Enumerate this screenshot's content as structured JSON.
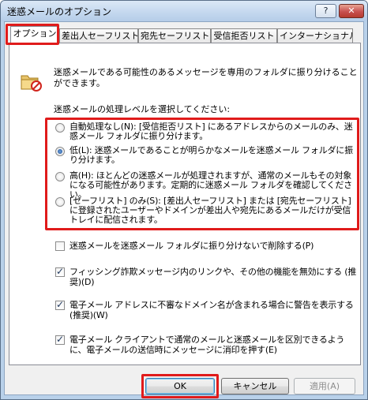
{
  "window": {
    "title": "迷惑メールのオプション",
    "help_label": "?",
    "close_label": "✕"
  },
  "tabs": [
    {
      "label": "オプション",
      "active": true
    },
    {
      "label": "差出人セーフリスト",
      "active": false
    },
    {
      "label": "宛先セーフリスト",
      "active": false
    },
    {
      "label": "受信拒否リスト",
      "active": false
    },
    {
      "label": "インターナショナル",
      "active": false
    }
  ],
  "options": {
    "intro_text": "迷惑メールである可能性のあるメッセージを専用のフォルダに振り分けることができます。",
    "level_label": "迷惑メールの処理レベルを選択してください:",
    "levels": [
      {
        "label": "自動処理なし(N): [受信拒否リスト] にあるアドレスからのメールのみ、迷惑メール フォルダに振り分けます。",
        "checked": false
      },
      {
        "label": "低(L): 迷惑メールであることが明らかなメールを迷惑メール フォルダに振り分けます。",
        "checked": true
      },
      {
        "label": "高(H): ほとんどの迷惑メールが処理されますが、通常のメールもその対象になる可能性があります。定期的に迷惑メール フォルダを確認してください。",
        "checked": false
      },
      {
        "label": "[セーフリスト] のみ(S): [差出人セーフリスト] または [宛先セーフリスト] に登録されたユーザーやドメインが差出人や宛先にあるメールだけが受信トレイに配信されます。",
        "checked": false
      }
    ],
    "checks": [
      {
        "label": "迷惑メールを迷惑メール フォルダに振り分けないで削除する(P)",
        "checked": false
      },
      {
        "label": "フィッシング詐欺メッセージ内のリンクや、その他の機能を無効にする (推奨)(D)",
        "checked": true
      },
      {
        "label": "電子メール アドレスに不審なドメイン名が含まれる場合に警告を表示する (推奨)(W)",
        "checked": true
      },
      {
        "label": "電子メール クライアントで通常のメールと迷惑メールを区別できるように、電子メールの送信時にメッセージに消印を押す(E)",
        "checked": true
      }
    ]
  },
  "buttons": {
    "ok": "OK",
    "cancel": "キャンセル",
    "apply": "適用(A)"
  },
  "colors": {
    "highlight": "#e01b1b"
  }
}
